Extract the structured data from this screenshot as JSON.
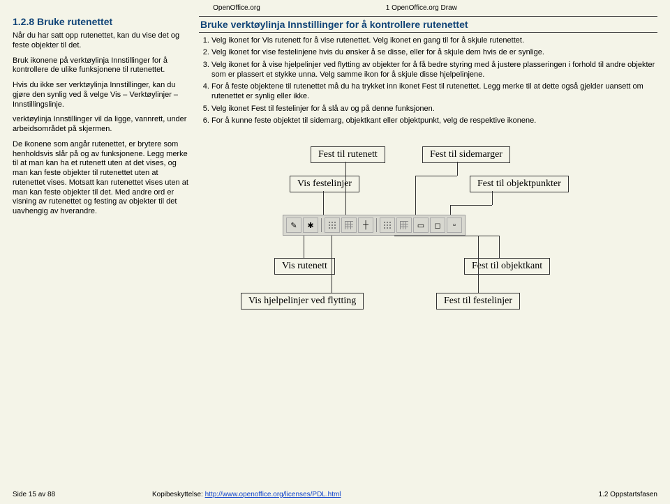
{
  "header": {
    "left": "OpenOffice.org",
    "right": "1 OpenOffice.org Draw"
  },
  "left": {
    "title": "1.2.8 Bruke rutenettet",
    "p1": "Når du har satt opp rutenettet, kan du vise det og feste objekter til det.",
    "p2": "Bruk ikonene på verktøylinja Innstillinger for å kontrollere de ulike funksjonene til rutenettet.",
    "p3": "Hvis du ikke ser verktøylinja Innstillinger, kan du gjøre den synlig ved å velge Vis – Verktøylinjer – Innstillingslinje.",
    "p4": "verktøylinja Innstillinger vil da ligge, vannrett, under arbeidsområdet på skjermen.",
    "p5": "De ikonene som angår rutenettet, er brytere som henholdsvis slår på og av funksjonene. Legg merke til at man kan ha et rutenett uten at det vises, og man kan feste objekter til rutenettet uten at rutenettet vises. Motsatt kan rutenettet vises uten at man kan feste objekter til det. Med andre ord er visning av rutenettet og festing av objekter til det uavhengig av hverandre."
  },
  "right": {
    "title": "Bruke verktøylinja Innstillinger for å kontrollere rutenettet",
    "steps": [
      "Velg ikonet for Vis rutenett for å vise rutenettet. Velg ikonet en gang til for å skjule rutenettet.",
      "Velg ikonet for vise festelinjene hvis du ønsker å se disse, eller for å skjule dem hvis de er synlige.",
      "Velg ikonet for å vise hjelpelinjer ved flytting av objekter for å få bedre styring med å justere plasseringen i forhold til andre objekter som er plassert et stykke unna. Velg samme ikon for å skjule disse hjelpelinjene.",
      "For å feste objektene til rutenettet må du ha trykket inn ikonet Fest til rutenettet. Legg merke til at dette også gjelder uansett om rutenettet er synlig eller ikke.",
      "Velg ikonet Fest til festelinjer for å slå av og på denne funksjonen.",
      "For å kunne feste objektet til sidemarg, objektkant eller objektpunkt, velg de respektive ikonene."
    ]
  },
  "labels": {
    "fest_rutenett": "Fest til rutenett",
    "fest_sidemarger": "Fest til sidemarger",
    "vis_festelinjer": "Vis festelinjer",
    "fest_objektpunkter": "Fest til objektpunkter",
    "vis_rutenett": "Vis rutenett",
    "fest_objektkant": "Fest til objektkant",
    "vis_hjelpelinjer": "Vis hjelpelinjer ved flytting",
    "fest_festelinjer": "Fest til festelinjer"
  },
  "footer": {
    "page": "Side 15 av 88",
    "copy_label": "Kopibeskyttelse: ",
    "copy_url": "http://www.openoffice.org/licenses/PDL.html",
    "section": "1.2 Oppstartsfasen"
  }
}
